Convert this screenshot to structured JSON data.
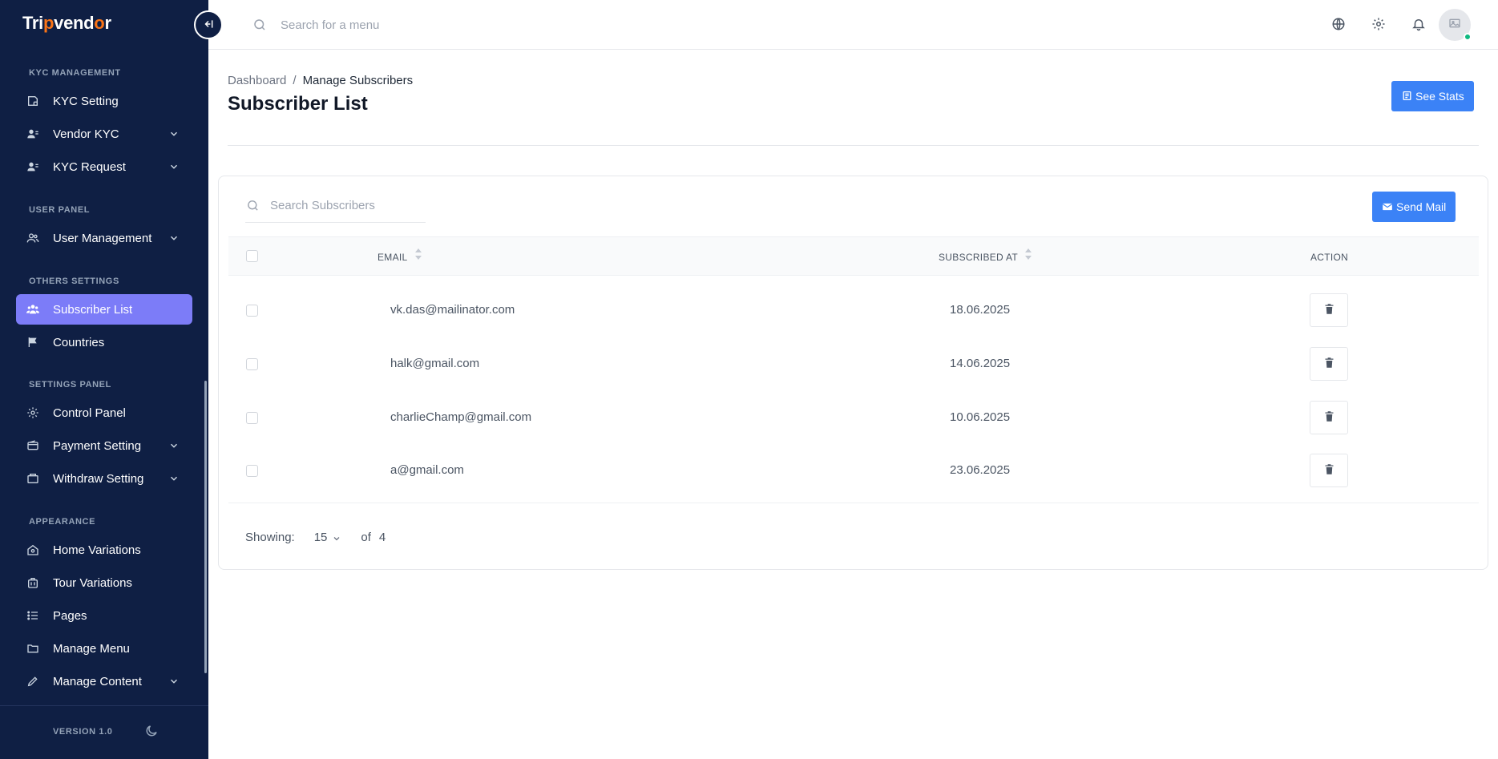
{
  "sidebar": {
    "logo": {
      "pre": "Tri",
      "accent": "p",
      "mid": "vend",
      "accent2": "o",
      "post": "r"
    },
    "sections": [
      {
        "title": "KYC MANAGEMENT"
      },
      {
        "title": "USER PANEL"
      },
      {
        "title": "OTHERS SETTINGS"
      },
      {
        "title": "SETTINGS PANEL"
      },
      {
        "title": "APPEARANCE"
      }
    ],
    "items": [
      {
        "label": "KYC Setting",
        "icon": "kyc-setting-icon",
        "has_chevron": false
      },
      {
        "label": "Vendor KYC",
        "icon": "users-icon",
        "has_chevron": true
      },
      {
        "label": "KYC Request",
        "icon": "users-icon",
        "has_chevron": true
      },
      {
        "label": "User Management",
        "icon": "user-group-icon",
        "has_chevron": true
      },
      {
        "label": "Subscriber List",
        "icon": "subscribers-icon",
        "has_chevron": false,
        "active": true
      },
      {
        "label": "Countries",
        "icon": "flag-icon",
        "has_chevron": false
      },
      {
        "label": "Control Panel",
        "icon": "gear-icon",
        "has_chevron": false
      },
      {
        "label": "Payment Setting",
        "icon": "wallet-icon",
        "has_chevron": true
      },
      {
        "label": "Withdraw Setting",
        "icon": "withdraw-icon",
        "has_chevron": true
      },
      {
        "label": "Home Variations",
        "icon": "home-icon",
        "has_chevron": false
      },
      {
        "label": "Tour Variations",
        "icon": "bag-icon",
        "has_chevron": false
      },
      {
        "label": "Pages",
        "icon": "list-icon",
        "has_chevron": false
      },
      {
        "label": "Manage Menu",
        "icon": "folder-icon",
        "has_chevron": false
      },
      {
        "label": "Manage Content",
        "icon": "pencil-icon",
        "has_chevron": true
      }
    ],
    "version": "VERSION 1.0"
  },
  "topbar": {
    "search_placeholder": "Search for a menu"
  },
  "header": {
    "breadcrumb": {
      "root": "Dashboard",
      "separator": "/",
      "current": "Manage Subscribers"
    },
    "title": "Subscriber List",
    "stats_button": "See Stats"
  },
  "card": {
    "search_placeholder": "Search Subscribers",
    "send_mail_button": "Send Mail",
    "columns": {
      "email": "EMAIL",
      "subscribed_at": "SUBSCRIBED AT",
      "action": "ACTION"
    },
    "rows": [
      {
        "email": "vk.das@mailinator.com",
        "date": "18.06.2025"
      },
      {
        "email": "halk@gmail.com",
        "date": "14.06.2025"
      },
      {
        "email": "charlieChamp@gmail.com",
        "date": "10.06.2025"
      },
      {
        "email": "a@gmail.com",
        "date": "23.06.2025"
      }
    ],
    "footer": {
      "showing_label": "Showing:",
      "per_page": "15",
      "of_label": "of",
      "total": "4"
    }
  },
  "colors": {
    "sidebar_bg": "#0f1f44",
    "active_item": "#7c7cf8",
    "primary": "#3b82f6",
    "accent": "#f97316",
    "online": "#10b981"
  }
}
